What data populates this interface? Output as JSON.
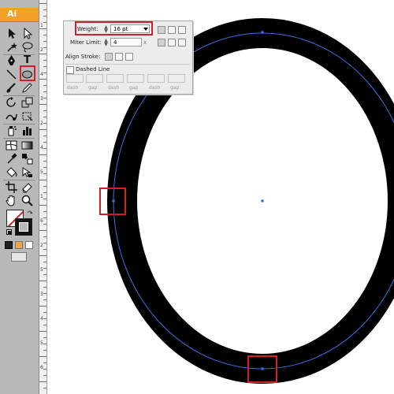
{
  "app": {
    "logo_text": "Ai",
    "logo_color": "#f2a027"
  },
  "tools": [
    {
      "name": "selection-tool-icon"
    },
    {
      "name": "direct-selection-tool-icon"
    },
    {
      "name": "magic-wand-tool-icon"
    },
    {
      "name": "lasso-tool-icon"
    },
    {
      "name": "pen-tool-icon"
    },
    {
      "name": "type-tool-icon",
      "glyph": "T"
    },
    {
      "name": "line-segment-tool-icon"
    },
    {
      "name": "ellipse-tool-icon",
      "selected": true
    },
    {
      "name": "paintbrush-tool-icon"
    },
    {
      "name": "pencil-tool-icon"
    },
    {
      "name": "rotate-tool-icon"
    },
    {
      "name": "scale-tool-icon"
    },
    {
      "name": "warp-tool-icon"
    },
    {
      "name": "free-transform-tool-icon"
    },
    {
      "name": "symbol-sprayer-tool-icon"
    },
    {
      "name": "column-graph-tool-icon"
    },
    {
      "name": "mesh-tool-icon"
    },
    {
      "name": "gradient-tool-icon"
    },
    {
      "name": "eyedropper-tool-icon"
    },
    {
      "name": "blend-tool-icon"
    },
    {
      "name": "live-paint-bucket-tool-icon"
    },
    {
      "name": "live-paint-selection-tool-icon"
    },
    {
      "name": "crop-area-tool-icon"
    },
    {
      "name": "eraser-tool-icon"
    },
    {
      "name": "hand-tool-icon"
    },
    {
      "name": "zoom-tool-icon"
    }
  ],
  "ruler_labels": [
    "1",
    "2",
    "4",
    "3",
    "2",
    "4",
    "5",
    "1",
    "6",
    "2",
    "5",
    "3",
    "4",
    "5",
    "6"
  ],
  "stroke_panel": {
    "weight_label": "Weight:",
    "weight_value": "16 pt",
    "miter_label": "Miter Limit:",
    "miter_value": "4",
    "miter_unit": "x",
    "align_label": "Align Stroke:",
    "dashed_label": "Dashed Line",
    "dash_labels": [
      "dash",
      "gap",
      "dash",
      "gap",
      "dash",
      "gap"
    ]
  },
  "artwork": {
    "stroke_color": "#000000",
    "path_color": "#3a6fe6",
    "highlight_color": "#d21f2a"
  }
}
